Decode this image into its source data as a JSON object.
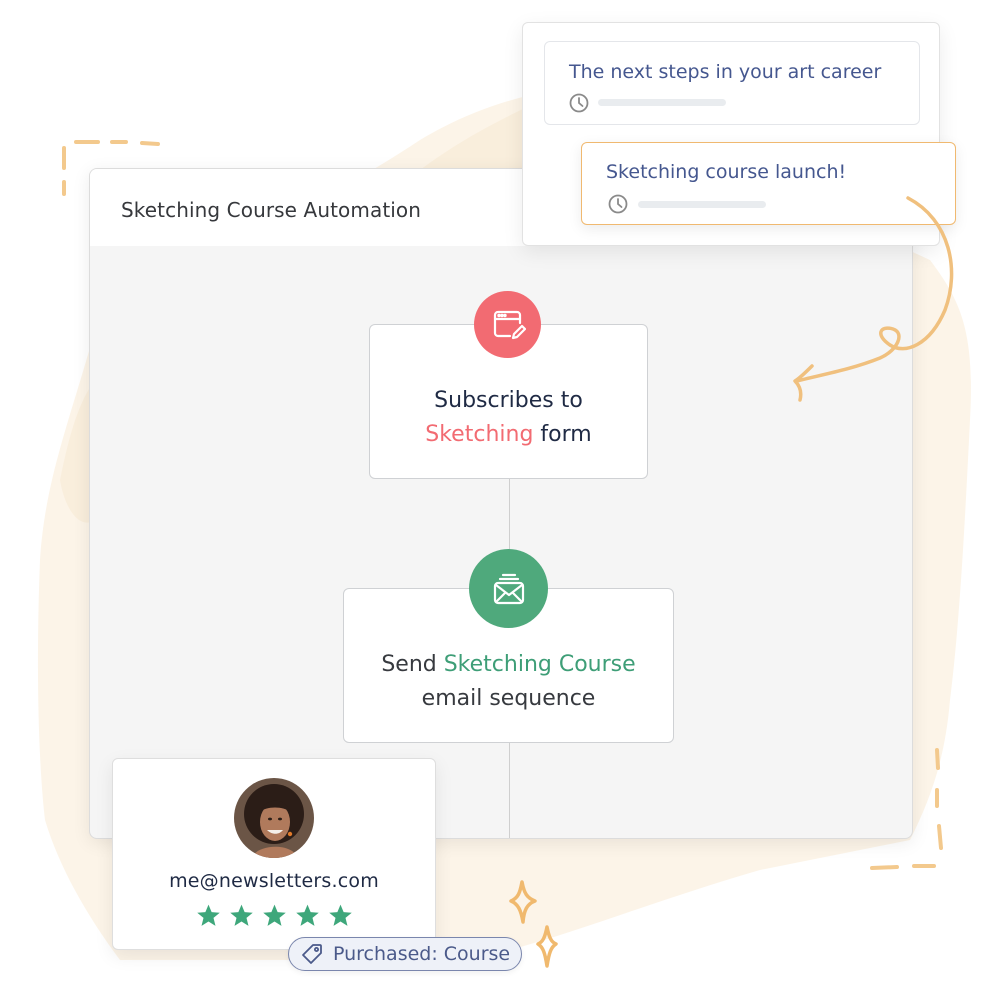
{
  "colors": {
    "accent_red": "#f26b72",
    "accent_green": "#4fa97c",
    "broadcast_blue": "#45578f",
    "highlight_orange": "#f0b970",
    "star_green": "#3ea77b",
    "decor_orange": "#f2c27f"
  },
  "automation": {
    "title": "Sketching Course Automation",
    "steps": [
      {
        "icon": "form-edit-icon",
        "line1": "Subscribes to",
        "highlight": "Sketching",
        "line2_rest": " form"
      },
      {
        "icon": "email-sequence-icon",
        "prefix": "Send ",
        "highlight": "Sketching Course",
        "line2": "email sequence"
      }
    ]
  },
  "broadcasts": {
    "items": [
      {
        "title": "The next steps in your art career",
        "icon": "clock-icon",
        "selected": false
      },
      {
        "title": "Sketching course launch!",
        "icon": "clock-icon",
        "selected": true
      }
    ]
  },
  "subscriber": {
    "email": "me@newsletters.com",
    "rating": 5,
    "rating_max": 5,
    "tag": {
      "icon": "tag-icon",
      "label": "Purchased: Course"
    }
  }
}
